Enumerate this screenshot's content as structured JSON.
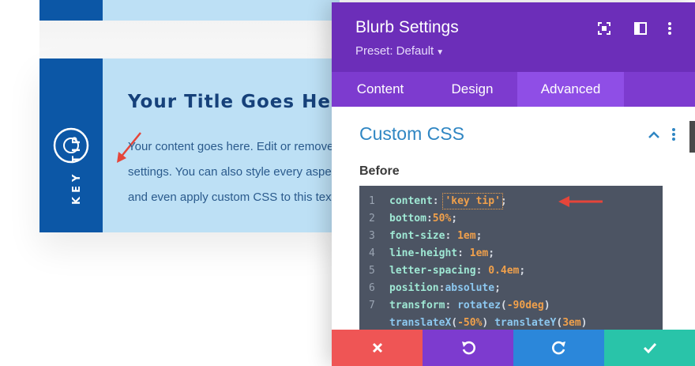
{
  "preview": {
    "title": "Your Title Goes Here",
    "body_lines": [
      "Your content goes here. Edit or remove this text inline or in the module Content",
      "settings. You can also style every aspect of this content in the module Design settings",
      "and even apply custom CSS to this text in the module Advanced settings."
    ],
    "keytip_label": "KEY TIP"
  },
  "modal": {
    "title": "Blurb Settings",
    "preset": "Preset: Default",
    "tabs": [
      "Content",
      "Design",
      "Advanced"
    ],
    "active_tab": "Advanced",
    "section_title": "Custom CSS",
    "field_label": "Before",
    "code_lines": [
      {
        "n": "1",
        "parts": [
          [
            "prop",
            "content"
          ],
          [
            "punc",
            ": "
          ],
          [
            "val keytip-str",
            "'key tip'"
          ],
          [
            "punc",
            ";"
          ]
        ]
      },
      {
        "n": "2",
        "parts": [
          [
            "prop",
            "bottom"
          ],
          [
            "punc",
            ":"
          ],
          [
            "val",
            "50%"
          ],
          [
            "punc",
            ";"
          ]
        ]
      },
      {
        "n": "3",
        "parts": [
          [
            "prop",
            "font-size"
          ],
          [
            "punc",
            ": "
          ],
          [
            "val",
            "1em"
          ],
          [
            "punc",
            ";"
          ]
        ]
      },
      {
        "n": "4",
        "parts": [
          [
            "prop",
            "line-height"
          ],
          [
            "punc",
            ": "
          ],
          [
            "val",
            "1em"
          ],
          [
            "punc",
            ";"
          ]
        ]
      },
      {
        "n": "5",
        "parts": [
          [
            "prop",
            "letter-spacing"
          ],
          [
            "punc",
            ": "
          ],
          [
            "val",
            "0.4em"
          ],
          [
            "punc",
            ";"
          ]
        ]
      },
      {
        "n": "6",
        "parts": [
          [
            "prop",
            "position"
          ],
          [
            "punc",
            ":"
          ],
          [
            "fn",
            "absolute"
          ],
          [
            "punc",
            ";"
          ]
        ]
      },
      {
        "n": "7",
        "parts": [
          [
            "prop",
            "transform"
          ],
          [
            "punc",
            ": "
          ],
          [
            "fn",
            "rotatez"
          ],
          [
            "punc",
            "("
          ],
          [
            "val",
            "-90deg"
          ],
          [
            "punc",
            ")"
          ]
        ]
      },
      {
        "n": "",
        "parts": [
          [
            "fn",
            "translateX"
          ],
          [
            "punc",
            "("
          ],
          [
            "val",
            "-50%"
          ],
          [
            "punc",
            ") "
          ],
          [
            "fn",
            "translateY"
          ],
          [
            "punc",
            "("
          ],
          [
            "val",
            "3em"
          ],
          [
            "punc",
            ")"
          ]
        ]
      }
    ]
  },
  "colors": {
    "header": "#6c2eb9",
    "tabs": "#7d3bcf",
    "active_tab": "#8f4ee6",
    "cancel": "#ef5555",
    "undo": "#7d3bcf",
    "redo": "#2b87da",
    "save": "#29c4a9",
    "annotation_arrow": "#e5453a"
  },
  "footer": {
    "cancel_icon": "close-icon",
    "undo_icon": "undo-icon",
    "redo_icon": "redo-icon",
    "save_icon": "check-icon"
  }
}
